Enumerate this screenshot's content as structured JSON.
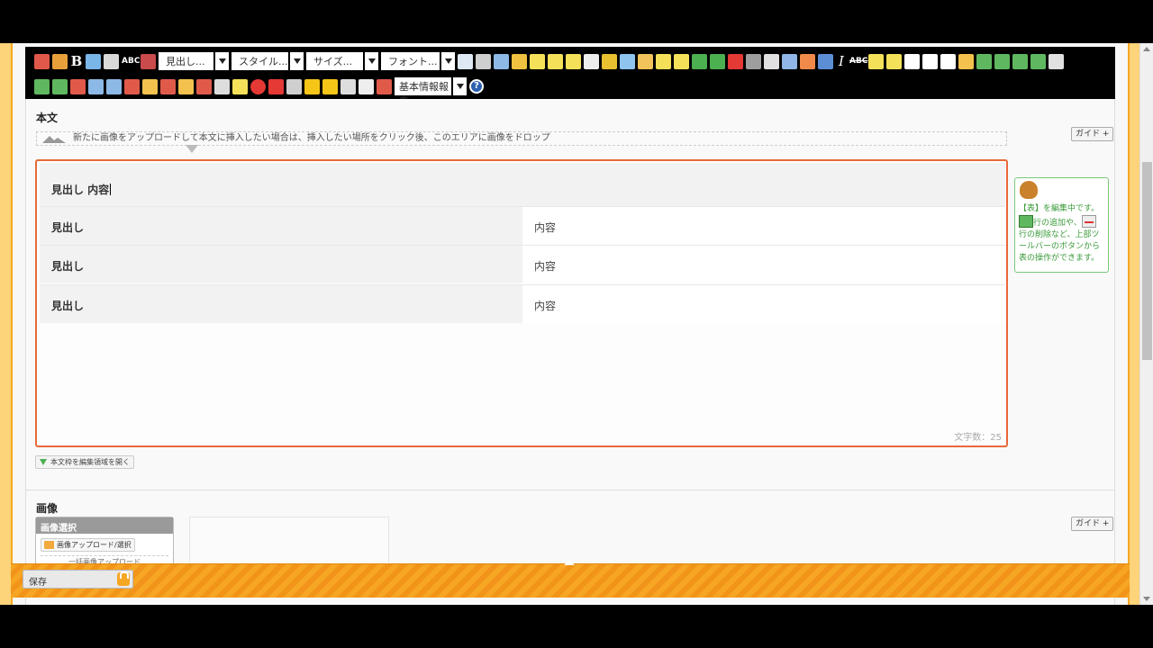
{
  "toolbar": {
    "bold_label": "B",
    "spell_label": "ABC",
    "strike_label": "ABC",
    "italic_label": "I",
    "heading_select": "見出し...",
    "style_select": "スタイル...",
    "size_select": "サイズ...",
    "font_select": "フォント...",
    "template_select": "基本情報報告",
    "help_label": "?"
  },
  "body_section": {
    "title": "本文",
    "guide_label": "ガイド +",
    "drop_hint": "新たに画像をアップロードして本文に挿入したい場合は、挿入したい場所をクリック後、このエリアに画像をドロップ",
    "caption_text": "見出し 内容",
    "rows": [
      {
        "heading": "見出し",
        "content": "内容"
      },
      {
        "heading": "見出し",
        "content": "内容"
      },
      {
        "heading": "見出し",
        "content": "内容"
      }
    ],
    "char_count": "文字数：25",
    "expand_label": "本文枠を編集領域を開く"
  },
  "tip": {
    "line1": "【表】を編集中です。",
    "line2": "行の追加や、",
    "line3": "行の削除など、上部ツールバーのボタンから表の操作ができます。"
  },
  "image_section": {
    "title": "画像",
    "guide_label": "ガイド +",
    "select_header": "画像選択",
    "upload_button": "画像アップロード/選択",
    "sub_label": "一括画像アップロード"
  },
  "save_bar": {
    "save_label": "保存"
  },
  "colors": {
    "accent": "#f6a623",
    "editor_border": "#e8693a",
    "tip_green": "#3a9a3a"
  }
}
